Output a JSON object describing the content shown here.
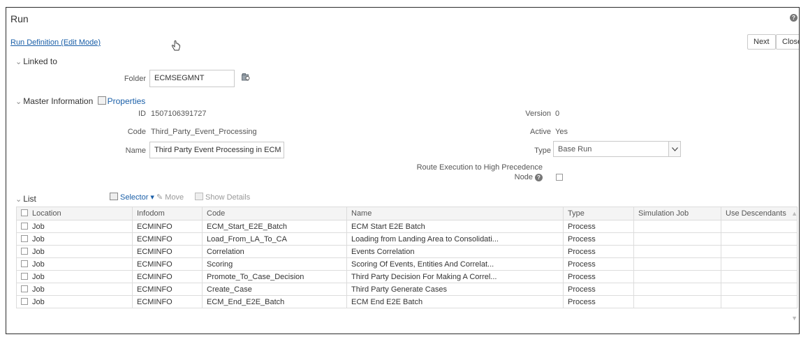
{
  "header": {
    "title": "Run",
    "breadcrumb_link": "Run Definition (Edit Mode)",
    "next_label": "Next",
    "close_label": "Close"
  },
  "linked_to": {
    "section_label": "Linked to",
    "folder_label": "Folder",
    "folder_value": "ECMSEGMNT"
  },
  "master": {
    "section_label": "Master Information",
    "properties_label": "Properties",
    "id_label": "ID",
    "id_value": "1507106391727",
    "code_label": "Code",
    "code_value": "Third_Party_Event_Processing",
    "name_label": "Name",
    "name_value": "Third Party Event Processing in ECM",
    "version_label": "Version",
    "version_value": "0",
    "active_label": "Active",
    "active_value": "Yes",
    "type_label": "Type",
    "type_value": "Base Run",
    "route_label_line1": "Route Execution to High Precedence",
    "route_label_line2": "Node"
  },
  "list": {
    "section_label": "List",
    "selector_label": "Selector",
    "move_label": "Move",
    "show_details_label": "Show Details",
    "columns": [
      "Location",
      "Infodom",
      "Code",
      "Name",
      "Type",
      "Simulation Job",
      "Use Descendants"
    ],
    "rows": [
      [
        "Job",
        "ECMINFO",
        "ECM_Start_E2E_Batch",
        "ECM Start E2E Batch",
        "Process",
        "",
        ""
      ],
      [
        "Job",
        "ECMINFO",
        "Load_From_LA_To_CA",
        "Loading from Landing Area to Consolidati...",
        "Process",
        "",
        ""
      ],
      [
        "Job",
        "ECMINFO",
        "Correlation",
        "Events Correlation",
        "Process",
        "",
        ""
      ],
      [
        "Job",
        "ECMINFO",
        "Scoring",
        "Scoring Of Events, Entities And Correlat...",
        "Process",
        "",
        ""
      ],
      [
        "Job",
        "ECMINFO",
        "Promote_To_Case_Decision",
        "Third Party Decision For Making A Correl...",
        "Process",
        "",
        ""
      ],
      [
        "Job",
        "ECMINFO",
        "Create_Case",
        "Third Party Generate Cases",
        "Process",
        "",
        ""
      ],
      [
        "Job",
        "ECMINFO",
        "ECM_End_E2E_Batch",
        "ECM End E2E Batch",
        "Process",
        "",
        ""
      ]
    ]
  },
  "icons": {
    "help": "help-icon",
    "folder_browse": "folder-browse-icon",
    "properties": "properties-icon",
    "pointer": "hand-pointer-icon"
  }
}
